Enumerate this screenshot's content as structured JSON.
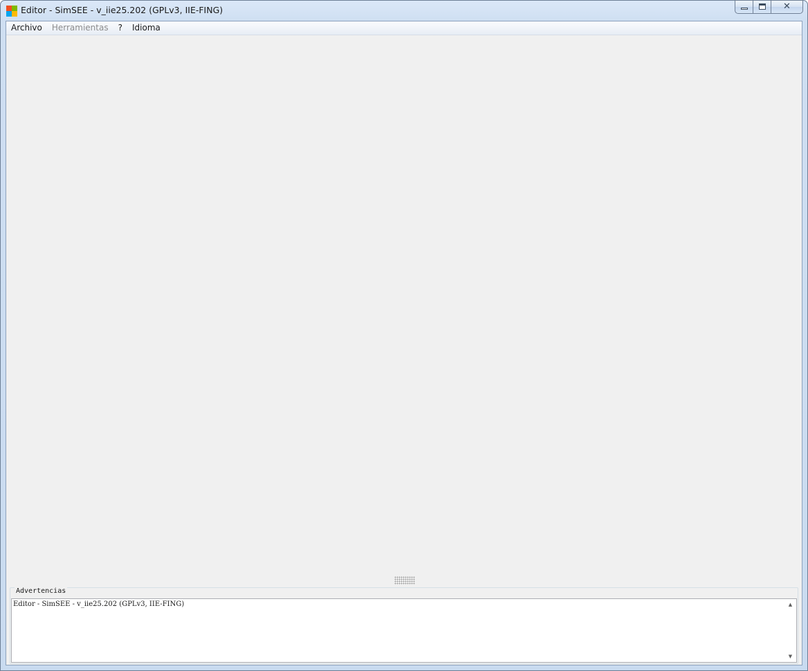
{
  "window": {
    "title": "Editor - SimSEE - v_iie25.202 (GPLv3, IIE-FING)",
    "app_icon": "windows-flag-icon",
    "caption_buttons": {
      "minimize_icon": "minimize-icon",
      "maximize_icon": "maximize-icon",
      "close_glyph": "✕"
    }
  },
  "menubar": {
    "items": [
      {
        "label": "Archivo",
        "enabled": true
      },
      {
        "label": "Herramientas",
        "enabled": false
      },
      {
        "label": "?",
        "enabled": true
      },
      {
        "label": "Idioma",
        "enabled": true
      }
    ]
  },
  "warnings": {
    "label": "Advertencias",
    "text": "Editor - SimSEE - v_iie25.202 (GPLv3, IIE-FING)",
    "scroll_up_glyph": "▲",
    "scroll_down_glyph": "▼"
  },
  "colors": {
    "client_background": "#f0f0f0",
    "disabled_text": "#8c8c8c",
    "frame": "#cfdff2"
  }
}
